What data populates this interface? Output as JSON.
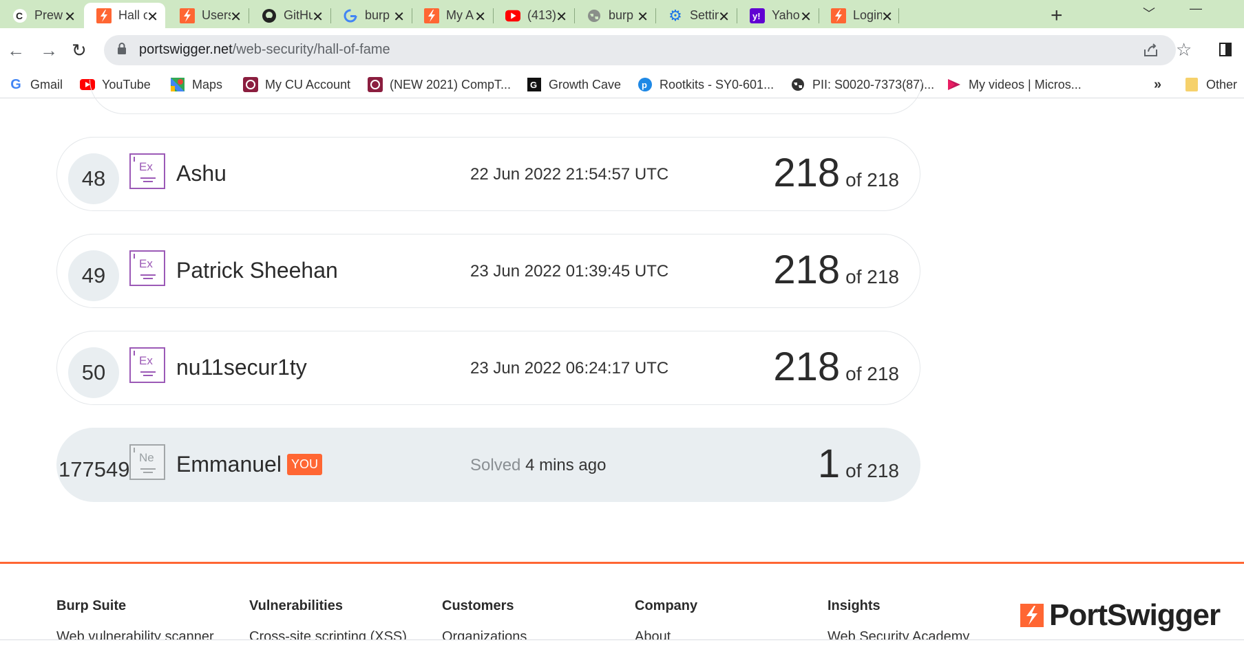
{
  "browser": {
    "tabs": [
      {
        "label": "Prew",
        "icon": "c-favicon",
        "active": false
      },
      {
        "label": "Hall o",
        "icon": "portswigger-favicon",
        "active": true
      },
      {
        "label": "Users",
        "icon": "portswigger-favicon",
        "active": false
      },
      {
        "label": "GitHu",
        "icon": "github-favicon",
        "active": false
      },
      {
        "label": "burp",
        "icon": "google-favicon",
        "active": false
      },
      {
        "label": "My A",
        "icon": "portswigger-favicon",
        "active": false
      },
      {
        "label": "(413)",
        "icon": "youtube-favicon",
        "active": false
      },
      {
        "label": "burp",
        "icon": "globe-favicon",
        "active": false
      },
      {
        "label": "Settin",
        "icon": "gear-favicon",
        "active": false
      },
      {
        "label": "Yaho",
        "icon": "yahoo-favicon",
        "active": false
      },
      {
        "label": "Login",
        "icon": "portswigger-favicon",
        "active": false
      }
    ],
    "close_glyph": "✕",
    "new_tab_glyph": "+",
    "url_domain": "portswigger.net",
    "url_path": "/web-security/hall-of-fame",
    "bookmarks": [
      {
        "label": "Gmail",
        "icon": "google-icon"
      },
      {
        "label": "YouTube",
        "icon": "youtube-icon"
      },
      {
        "label": "Maps",
        "icon": "maps-icon"
      },
      {
        "label": "My CU Account",
        "icon": "cu-icon"
      },
      {
        "label": "(NEW 2021) CompT...",
        "icon": "cu-icon"
      },
      {
        "label": "Growth Cave",
        "icon": "g-icon"
      },
      {
        "label": "Rootkits - SY0-601...",
        "icon": "p-icon"
      },
      {
        "label": "PII: S0020-7373(87)...",
        "icon": "globe-icon"
      },
      {
        "label": "My videos | Micros...",
        "icon": "stream-icon"
      }
    ],
    "bookmarks_overflow": "»",
    "other_bookmarks": "Other"
  },
  "leaderboard": [
    {
      "rank": "48",
      "badge": "Ex",
      "name": "Ashu",
      "date": "22 Jun 2022 21:54:57 UTC",
      "score": "218",
      "of": "of 218"
    },
    {
      "rank": "49",
      "badge": "Ex",
      "name": "Patrick Sheehan",
      "date": "23 Jun 2022 01:39:45 UTC",
      "score": "218",
      "of": "of 218"
    },
    {
      "rank": "50",
      "badge": "Ex",
      "name": "nu11secur1ty",
      "date": "23 Jun 2022 06:24:17 UTC",
      "score": "218",
      "of": "of 218"
    }
  ],
  "current_user": {
    "rank": "177549",
    "badge": "Ne",
    "name": "Emmanuel",
    "you_tag": "YOU",
    "solved_prefix": "Solved",
    "solved_time": "4 mins ago",
    "score": "1",
    "of": "of 218"
  },
  "footer": {
    "columns": [
      {
        "heading": "Burp Suite",
        "first_link": "Web vulnerability scanner"
      },
      {
        "heading": "Vulnerabilities",
        "first_link": "Cross-site scripting (XSS)"
      },
      {
        "heading": "Customers",
        "first_link": "Organizations"
      },
      {
        "heading": "Company",
        "first_link": "About"
      },
      {
        "heading": "Insights",
        "first_link": "Web Security Academy"
      }
    ],
    "logo_text": "PortSwigger"
  },
  "colors": {
    "accent": "#ff6633",
    "expert_badge": "#9b59b6",
    "tabbar": "#cfe8c4"
  }
}
